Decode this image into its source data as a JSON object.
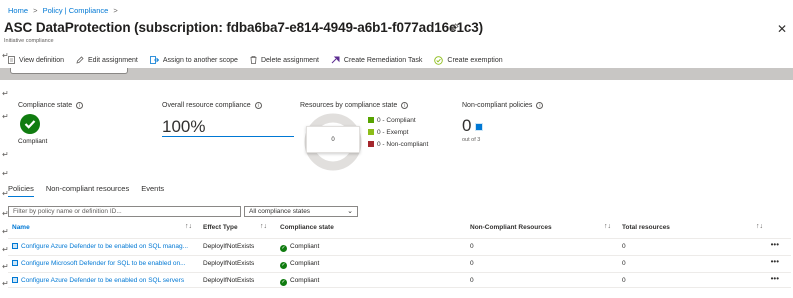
{
  "breadcrumb": {
    "items": [
      "Home",
      "Policy | Compliance"
    ],
    "separator": ">"
  },
  "header": {
    "title": "ASC DataProtection (subscription: fdba6ba7-e814-4949-a6b1-f077ad16e1c3)",
    "subtitle": "Initiative compliance",
    "pin_icon": "pin-icon",
    "more_icon": "ellipsis-icon",
    "close_icon": "close-icon"
  },
  "toolbar": {
    "view_definition": "View definition",
    "edit_assignment": "Edit assignment",
    "assign_scope": "Assign to another scope",
    "delete_assignment": "Delete assignment",
    "create_remediation": "Create Remediation Task",
    "create_exemption": "Create exemption"
  },
  "paragraph_mark": "↵",
  "stats": {
    "compliance_state_label": "Compliance state",
    "compliance_state_value": "Compliant",
    "overall_label": "Overall resource compliance",
    "overall_value": "100%",
    "resources_label": "Resources by compliance state",
    "donut_center": "0",
    "legend": [
      {
        "label": "0 - Compliant",
        "color": "#57a300"
      },
      {
        "label": "0 - Exempt",
        "color": "#8cbd18"
      },
      {
        "label": "0 - Non-compliant",
        "color": "#a4262c"
      }
    ],
    "noncompliant_label": "Non-compliant policies",
    "noncompliant_value": "0",
    "noncompliant_sub": "out of 3"
  },
  "tabs": [
    "Policies",
    "Non-compliant resources",
    "Events"
  ],
  "filter": {
    "placeholder": "Filter by policy name or definition ID...",
    "select_value": "All compliance states"
  },
  "table": {
    "columns": [
      "Name",
      "Effect Type",
      "Compliance state",
      "Non-Compliant Resources",
      "Total resources"
    ],
    "rows": [
      {
        "name": "Configure Azure Defender to be enabled on SQL manag...",
        "effect": "DeployIfNotExists",
        "state": "Compliant",
        "noncompliant": "0",
        "total": "0"
      },
      {
        "name": "Configure Microsoft Defender for SQL to be enabled on...",
        "effect": "DeployIfNotExists",
        "state": "Compliant",
        "noncompliant": "0",
        "total": "0"
      },
      {
        "name": "Configure Azure Defender to be enabled on SQL servers",
        "effect": "DeployIfNotExists",
        "state": "Compliant",
        "noncompliant": "0",
        "total": "0"
      }
    ],
    "more_label": "•••"
  },
  "colors": {
    "accent": "#0078d4",
    "success": "#107c10"
  }
}
